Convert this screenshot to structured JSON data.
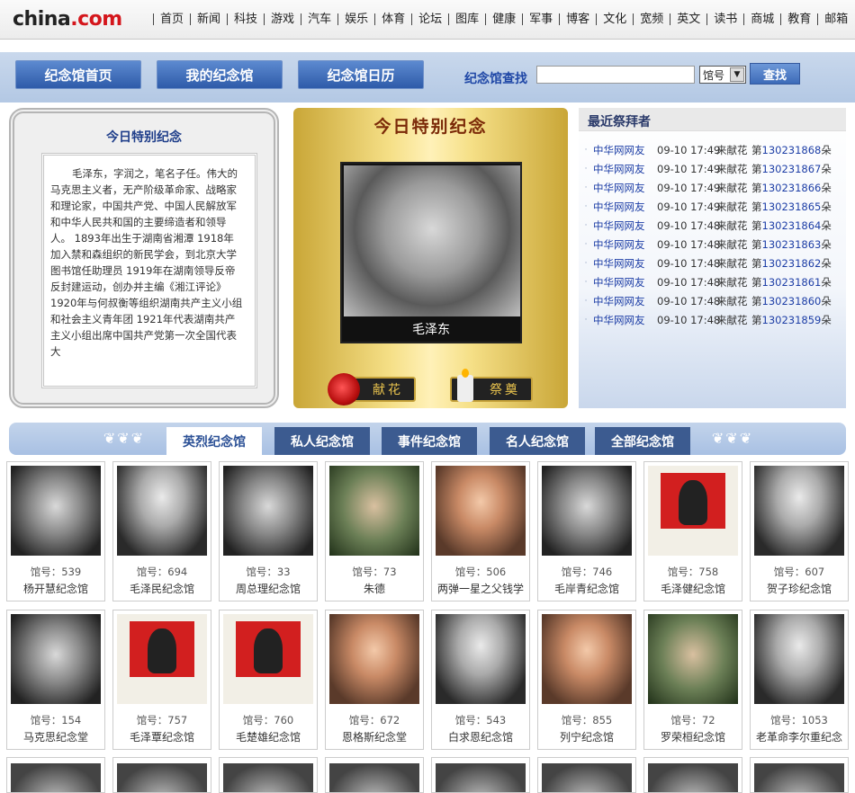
{
  "site": {
    "logo_main": "china",
    "logo_suffix": ".com",
    "nav": [
      "首页",
      "新闻",
      "科技",
      "游戏",
      "汽车",
      "娱乐",
      "体育",
      "论坛",
      "图库",
      "健康",
      "军事",
      "博客",
      "文化",
      "宽频",
      "英文",
      "读书",
      "商城",
      "教育",
      "邮箱"
    ]
  },
  "membar": {
    "home": "纪念馆首页",
    "mine": "我的纪念馆",
    "calendar": "纪念馆日历",
    "search_label": "纪念馆查找",
    "search_value": "",
    "select_value": "馆号",
    "search_button": "查找"
  },
  "today": {
    "title": "今日特别纪念",
    "bio": "毛泽东，字润之，笔名子任。伟大的马克思主义者，无产阶级革命家、战略家和理论家，中国共产党、中国人民解放军和中华人民共和国的主要缔造者和领导人。 1893年出生于湖南省湘潭 1918年加入禁和森组织的新民学会，到北京大学图书馆任助理员 1919年在湖南领导反帝反封建运动，创办并主编《湘江评论》 1920年与何叔衡等组织湖南共产主义小组和社会主义青年团 1921年代表湖南共产主义小组出席中国共产党第一次全国代表大",
    "gold_title": "今日特别纪念",
    "photo_name": "毛泽东",
    "flower": "献花",
    "candle": "祭奠"
  },
  "recent": {
    "title": "最近祭拜者",
    "items": [
      {
        "who": "中华网网友",
        "time": "09-10 17:49",
        "act": "来献花",
        "pre": "第",
        "num": "130231868",
        "unit": "朵"
      },
      {
        "who": "中华网网友",
        "time": "09-10 17:49",
        "act": "来献花",
        "pre": "第",
        "num": "130231867",
        "unit": "朵"
      },
      {
        "who": "中华网网友",
        "time": "09-10 17:49",
        "act": "来献花",
        "pre": "第",
        "num": "130231866",
        "unit": "朵"
      },
      {
        "who": "中华网网友",
        "time": "09-10 17:49",
        "act": "来献花",
        "pre": "第",
        "num": "130231865",
        "unit": "朵"
      },
      {
        "who": "中华网网友",
        "time": "09-10 17:48",
        "act": "来献花",
        "pre": "第",
        "num": "130231864",
        "unit": "朵"
      },
      {
        "who": "中华网网友",
        "time": "09-10 17:48",
        "act": "来献花",
        "pre": "第",
        "num": "130231863",
        "unit": "朵"
      },
      {
        "who": "中华网网友",
        "time": "09-10 17:48",
        "act": "来献花",
        "pre": "第",
        "num": "130231862",
        "unit": "朵"
      },
      {
        "who": "中华网网友",
        "time": "09-10 17:48",
        "act": "来献花",
        "pre": "第",
        "num": "130231861",
        "unit": "朵"
      },
      {
        "who": "中华网网友",
        "time": "09-10 17:48",
        "act": "来献花",
        "pre": "第",
        "num": "130231860",
        "unit": "朵"
      },
      {
        "who": "中华网网友",
        "time": "09-10 17:48",
        "act": "来献花",
        "pre": "第",
        "num": "130231859",
        "unit": "朵"
      }
    ]
  },
  "categories": [
    "英烈纪念馆",
    "私人纪念馆",
    "事件纪念馆",
    "名人纪念馆",
    "全部纪念馆"
  ],
  "gallery": [
    {
      "num": "馆号：539",
      "name": "杨开慧纪念馆",
      "style": "bw"
    },
    {
      "num": "馆号：694",
      "name": "毛泽民纪念馆",
      "style": "bw2"
    },
    {
      "num": "馆号：33",
      "name": "周总理纪念馆",
      "style": "bw"
    },
    {
      "num": "馆号：73",
      "name": "朱德",
      "style": "mil"
    },
    {
      "num": "馆号：506",
      "name": "两弹一星之父钱学",
      "style": "color"
    },
    {
      "num": "馆号：746",
      "name": "毛岸青纪念馆",
      "style": "bw"
    },
    {
      "num": "馆号：758",
      "name": "毛泽健纪念馆",
      "style": "poster"
    },
    {
      "num": "馆号：607",
      "name": "贺子珍纪念馆",
      "style": "bw2"
    },
    {
      "num": "馆号：154",
      "name": "马克思纪念堂",
      "style": "bw"
    },
    {
      "num": "馆号：757",
      "name": "毛泽覃纪念馆",
      "style": "poster"
    },
    {
      "num": "馆号：760",
      "name": "毛楚雄纪念馆",
      "style": "poster"
    },
    {
      "num": "馆号：672",
      "name": "恩格斯纪念堂",
      "style": "color"
    },
    {
      "num": "馆号：543",
      "name": "白求恩纪念馆",
      "style": "bw2"
    },
    {
      "num": "馆号：855",
      "name": "列宁纪念馆",
      "style": "color"
    },
    {
      "num": "馆号：72",
      "name": "罗荣桓纪念馆",
      "style": "mil"
    },
    {
      "num": "馆号：1053",
      "name": "老革命李尔重纪念",
      "style": "bw2"
    }
  ],
  "colors": {
    "nav_blue": "#2e5ba9",
    "link_blue": "#1d3ea6",
    "gold": "#f5df86",
    "accent_red": "#d4161c"
  }
}
